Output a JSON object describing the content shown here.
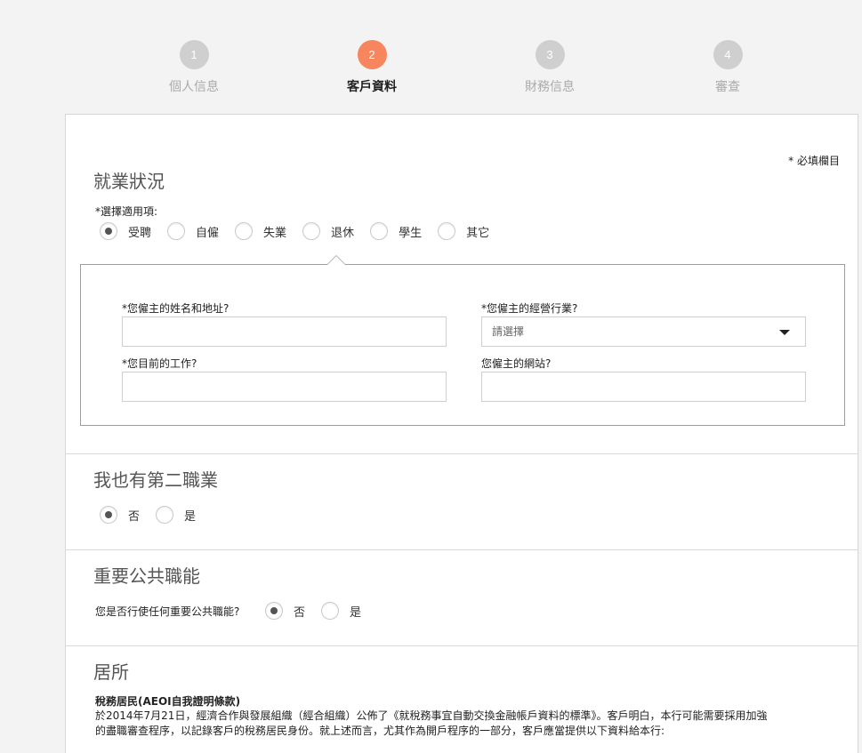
{
  "stepper": {
    "steps": [
      {
        "number": "1",
        "label": "個人信息"
      },
      {
        "number": "2",
        "label": "客戶資料"
      },
      {
        "number": "3",
        "label": "財務信息"
      },
      {
        "number": "4",
        "label": "審查"
      }
    ],
    "active_index": 1
  },
  "form": {
    "required_note": "* 必填欄目",
    "employment": {
      "title": "就業狀況",
      "select_label": "*選擇適用項:",
      "options": [
        "受聘",
        "自僱",
        "失業",
        "退休",
        "學生",
        "其它"
      ],
      "selected": "受聘",
      "employer_name_label": "*您僱主的姓名和地址?",
      "employer_name_value": "",
      "industry_label": "*您僱主的經營行業?",
      "industry_value": "請選擇",
      "job_label": "*您目前的工作?",
      "job_value": "",
      "website_label": "您僱主的網站?",
      "website_value": ""
    },
    "second_job": {
      "title": "我也有第二職業",
      "options": [
        "否",
        "是"
      ],
      "selected": "否"
    },
    "pep": {
      "title": "重要公共職能",
      "question": "您是否行使任何重要公共職能?",
      "options": [
        "否",
        "是"
      ],
      "selected": "否"
    },
    "residence": {
      "title": "居所",
      "heading": "稅務居民(AEOI自我證明條款)",
      "body": "於2014年7月21日，經濟合作與發展組織（經合組織）公佈了《就稅務事宜自動交換金融帳戶資料的標準》。客戶明白，本行可能需要採用加強的盡職審查程序，以記錄客戶的稅務居民身份。就上述而言，尤其作為開戶程序的一部分，客戶應當提供以下資料給本行:"
    }
  },
  "colors": {
    "accent": "#f7855d",
    "inactive_step": "#cfcfcf"
  }
}
